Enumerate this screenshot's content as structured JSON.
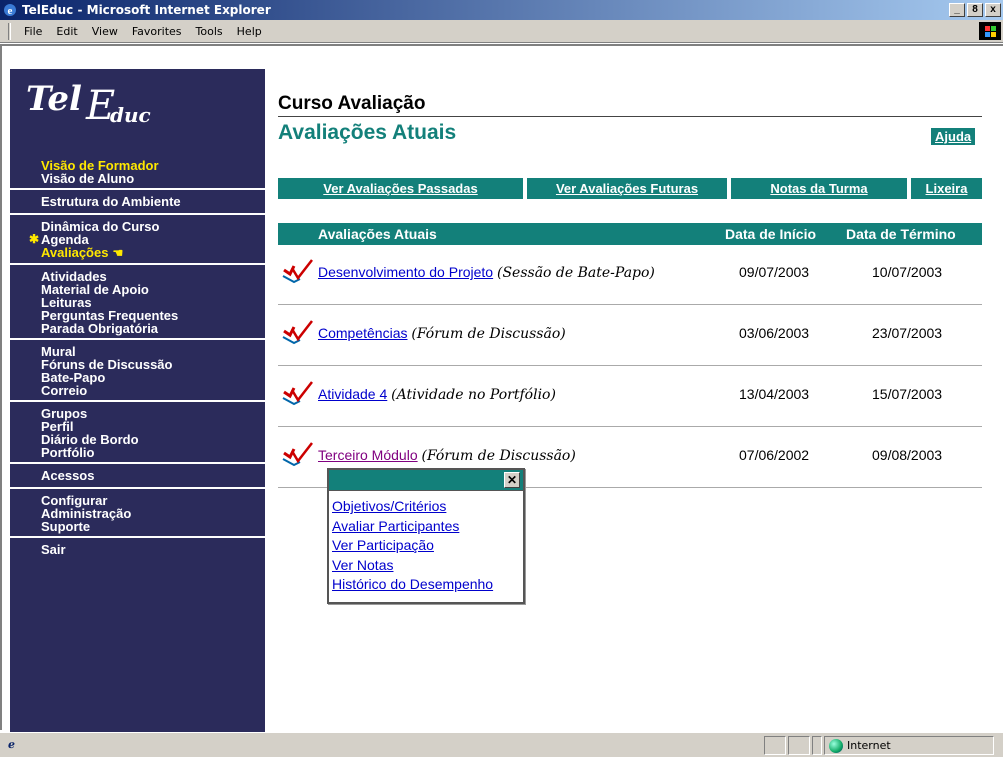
{
  "window": {
    "title": "TelEduc - Microsoft Internet Explorer",
    "buttons": [
      "_",
      "8",
      "x"
    ]
  },
  "menu": [
    "File",
    "Edit",
    "View",
    "Favorites",
    "Tools",
    "Help"
  ],
  "logo": {
    "part1": "Tel",
    "part2": "E",
    "part3": "duc"
  },
  "sidebar": {
    "groups": [
      [
        {
          "label": "Visão de Formador",
          "highlight": true
        },
        {
          "label": "Visão de Aluno"
        }
      ],
      [
        {
          "label": "Estrutura do Ambiente"
        }
      ],
      [
        {
          "label": "Dinâmica do Curso"
        },
        {
          "label": "Agenda",
          "new": true
        },
        {
          "label": "Avaliações",
          "highlight": true,
          "current": true
        }
      ],
      [
        {
          "label": "Atividades"
        },
        {
          "label": "Material de Apoio"
        },
        {
          "label": "Leituras"
        },
        {
          "label": "Perguntas Frequentes"
        },
        {
          "label": "Parada Obrigatória"
        }
      ],
      [
        {
          "label": "Mural"
        },
        {
          "label": "Fóruns de Discussão"
        },
        {
          "label": "Bate-Papo"
        },
        {
          "label": "Correio"
        }
      ],
      [
        {
          "label": "Grupos"
        },
        {
          "label": "Perfil"
        },
        {
          "label": "Diário de Bordo"
        },
        {
          "label": "Portfólio"
        }
      ],
      [
        {
          "label": "Acessos"
        }
      ],
      [
        {
          "label": "Configurar"
        },
        {
          "label": "Administração"
        },
        {
          "label": "Suporte"
        }
      ],
      [
        {
          "label": "Sair"
        }
      ]
    ]
  },
  "main": {
    "course_title": "Curso Avaliação",
    "page_title": "Avaliações Atuais",
    "help": "Ajuda",
    "tabs": [
      "Ver Avaliações Passadas",
      "Ver Avaliações Futuras",
      "Notas da Turma",
      "Lixeira"
    ],
    "table": {
      "headers": [
        "Avaliações Atuais",
        "Data de Início",
        "Data de Término"
      ],
      "rows": [
        {
          "name": "Desenvolvimento do Projeto",
          "type": "(Sessão de Bate-Papo)",
          "start": "09/07/2003",
          "end": "10/07/2003"
        },
        {
          "name": "Competências",
          "type": "(Fórum de Discussão)",
          "start": "03/06/2003",
          "end": "23/07/2003"
        },
        {
          "name": "Atividade 4",
          "type": "(Atividade no Portfólio)",
          "start": "13/04/2003",
          "end": "15/07/2003"
        },
        {
          "name": "Terceiro Módulo",
          "type": "(Fórum de Discussão)",
          "start": "07/06/2002",
          "end": "09/08/2003",
          "visited": true
        }
      ]
    }
  },
  "popup": {
    "close": "✕",
    "links": [
      "Objetivos/Critérios",
      "Avaliar Participantes",
      "Ver Participação",
      "Ver Notas",
      "Histórico do Desempenho"
    ]
  },
  "status": {
    "zone": "Internet"
  },
  "colors": {
    "accent": "#13807a",
    "sidebar": "#2b2b5b",
    "highlight": "#ffe800"
  }
}
